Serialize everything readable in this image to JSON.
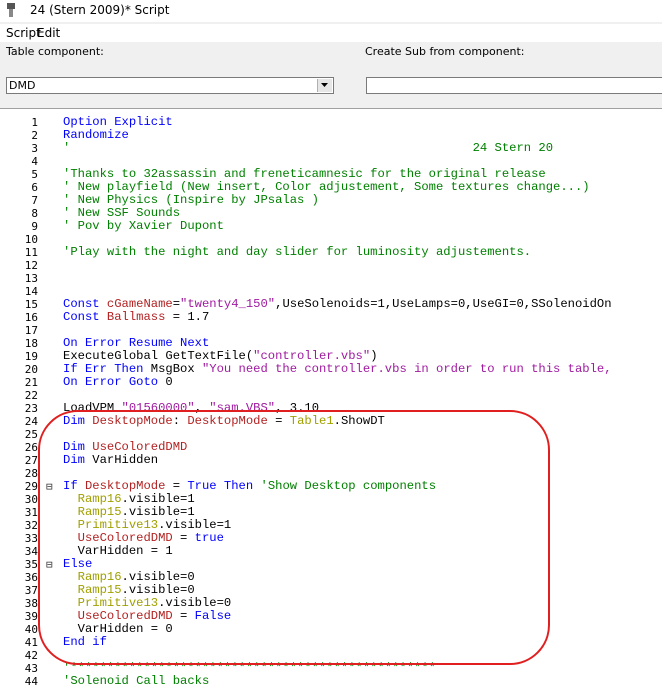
{
  "window": {
    "title": "24 (Stern 2009)* Script",
    "icon": "script-icon"
  },
  "menu": {
    "items": [
      "Script",
      "Edit"
    ]
  },
  "labels": {
    "table_component": "Table component:",
    "create_sub": "Create Sub from component:"
  },
  "combos": {
    "table_component_value": "DMD",
    "create_sub_value": ""
  },
  "editor": {
    "lines": [
      {
        "n": "1",
        "t": [
          [
            "k",
            "Option Explicit"
          ]
        ]
      },
      {
        "n": "2",
        "t": [
          [
            "k",
            "Randomize"
          ]
        ]
      },
      {
        "n": "3",
        "t": [
          [
            "c",
            "'                                                       24 Stern 20"
          ]
        ]
      },
      {
        "n": "4",
        "t": []
      },
      {
        "n": "5",
        "t": [
          [
            "c",
            "'Thanks to 32assassin and freneticamnesic for the original release"
          ]
        ]
      },
      {
        "n": "6",
        "t": [
          [
            "c",
            "' New playfield (New insert, Color adjustement, Some textures change...)"
          ]
        ]
      },
      {
        "n": "7",
        "t": [
          [
            "c",
            "' New Physics (Inspire by JPsalas )"
          ]
        ]
      },
      {
        "n": "8",
        "t": [
          [
            "c",
            "' New SSF Sounds"
          ]
        ]
      },
      {
        "n": "9",
        "t": [
          [
            "c",
            "' Pov by Xavier Dupont"
          ]
        ]
      },
      {
        "n": "10",
        "t": []
      },
      {
        "n": "11",
        "t": [
          [
            "c",
            "'Play with the night and day slider for luminosity adjustements."
          ]
        ]
      },
      {
        "n": "12",
        "t": []
      },
      {
        "n": "13",
        "t": []
      },
      {
        "n": "14",
        "t": []
      },
      {
        "n": "15",
        "t": [
          [
            "k",
            "Const "
          ],
          [
            "d",
            "cGameName"
          ],
          [
            "p",
            "="
          ],
          [
            "s",
            "\"twenty4_150\""
          ],
          [
            "p",
            ",UseSolenoids=1,UseLamps=0,UseGI=0,SSolenoidOn"
          ]
        ]
      },
      {
        "n": "16",
        "t": [
          [
            "k",
            "Const "
          ],
          [
            "d",
            "Ballmass"
          ],
          [
            "p",
            " = 1.7"
          ]
        ]
      },
      {
        "n": "17",
        "t": []
      },
      {
        "n": "18",
        "t": [
          [
            "k",
            "On Error Resume Next"
          ]
        ]
      },
      {
        "n": "19",
        "t": [
          [
            "p",
            "ExecuteGlobal GetTextFile("
          ],
          [
            "s",
            "\"controller.vbs\""
          ],
          [
            "p",
            ")"
          ]
        ]
      },
      {
        "n": "20",
        "t": [
          [
            "k",
            "If Err Then "
          ],
          [
            "p",
            "MsgBox "
          ],
          [
            "s",
            "\"You need the controller.vbs in order to run this table,"
          ]
        ]
      },
      {
        "n": "21",
        "t": [
          [
            "k",
            "On Error Goto "
          ],
          [
            "p",
            "0"
          ]
        ]
      },
      {
        "n": "22",
        "t": []
      },
      {
        "n": "23",
        "t": [
          [
            "p",
            "LoadVPM "
          ],
          [
            "s",
            "\"01560000\""
          ],
          [
            "p",
            ", "
          ],
          [
            "s",
            "\"sam.VBS\""
          ],
          [
            "p",
            ", 3.10"
          ]
        ]
      },
      {
        "n": "24",
        "t": [
          [
            "k",
            "Dim "
          ],
          [
            "d",
            "DesktopMode"
          ],
          [
            "p",
            ": "
          ],
          [
            "d",
            "DesktopMode"
          ],
          [
            "p",
            " = "
          ],
          [
            "o",
            "Table1"
          ],
          [
            "p",
            ".ShowDT"
          ]
        ]
      },
      {
        "n": "25",
        "t": []
      },
      {
        "n": "26",
        "t": [
          [
            "k",
            "Dim "
          ],
          [
            "d",
            "UseColoredDMD"
          ]
        ]
      },
      {
        "n": "27",
        "t": [
          [
            "k",
            "Dim "
          ],
          [
            "p",
            "VarHidden"
          ]
        ]
      },
      {
        "n": "28",
        "t": []
      },
      {
        "n": "29",
        "fold": "⊟",
        "t": [
          [
            "k",
            "If "
          ],
          [
            "d",
            "DesktopMode"
          ],
          [
            "p",
            " = "
          ],
          [
            "k",
            "True Then "
          ],
          [
            "c",
            "'Show Desktop components"
          ]
        ]
      },
      {
        "n": "30",
        "t": [
          [
            "p",
            "  "
          ],
          [
            "o",
            "Ramp16"
          ],
          [
            "p",
            ".visible=1"
          ]
        ]
      },
      {
        "n": "31",
        "t": [
          [
            "p",
            "  "
          ],
          [
            "o",
            "Ramp15"
          ],
          [
            "p",
            ".visible=1"
          ]
        ]
      },
      {
        "n": "32",
        "t": [
          [
            "p",
            "  "
          ],
          [
            "o",
            "Primitive13"
          ],
          [
            "p",
            ".visible=1"
          ]
        ]
      },
      {
        "n": "33",
        "t": [
          [
            "p",
            "  "
          ],
          [
            "d",
            "UseColoredDMD"
          ],
          [
            "p",
            " = "
          ],
          [
            "k",
            "true"
          ]
        ]
      },
      {
        "n": "34",
        "t": [
          [
            "p",
            "  VarHidden = 1"
          ]
        ]
      },
      {
        "n": "35",
        "fold": "⊟",
        "t": [
          [
            "k",
            "Else"
          ]
        ]
      },
      {
        "n": "36",
        "t": [
          [
            "p",
            "  "
          ],
          [
            "o",
            "Ramp16"
          ],
          [
            "p",
            ".visible=0"
          ]
        ]
      },
      {
        "n": "37",
        "t": [
          [
            "p",
            "  "
          ],
          [
            "o",
            "Ramp15"
          ],
          [
            "p",
            ".visible=0"
          ]
        ]
      },
      {
        "n": "38",
        "t": [
          [
            "p",
            "  "
          ],
          [
            "o",
            "Primitive13"
          ],
          [
            "p",
            ".visible=0"
          ]
        ]
      },
      {
        "n": "39",
        "t": [
          [
            "p",
            "  "
          ],
          [
            "d",
            "UseColoredDMD"
          ],
          [
            "p",
            " = "
          ],
          [
            "k",
            "False"
          ]
        ]
      },
      {
        "n": "40",
        "t": [
          [
            "p",
            "  VarHidden = 0"
          ]
        ]
      },
      {
        "n": "41",
        "t": [
          [
            "k",
            "End if"
          ]
        ]
      },
      {
        "n": "42",
        "t": []
      },
      {
        "n": "43",
        "t": [
          [
            "stars",
            "'**************************************************"
          ]
        ]
      },
      {
        "n": "44",
        "t": [
          [
            "c",
            "'Solenoid Call backs"
          ]
        ]
      }
    ]
  },
  "colors": {
    "keyword": "#0000ff",
    "string": "#a01aa0",
    "comment": "#008000",
    "object": "#a0a000",
    "variable": "#b22222",
    "highlight_circle": "#e02020"
  }
}
